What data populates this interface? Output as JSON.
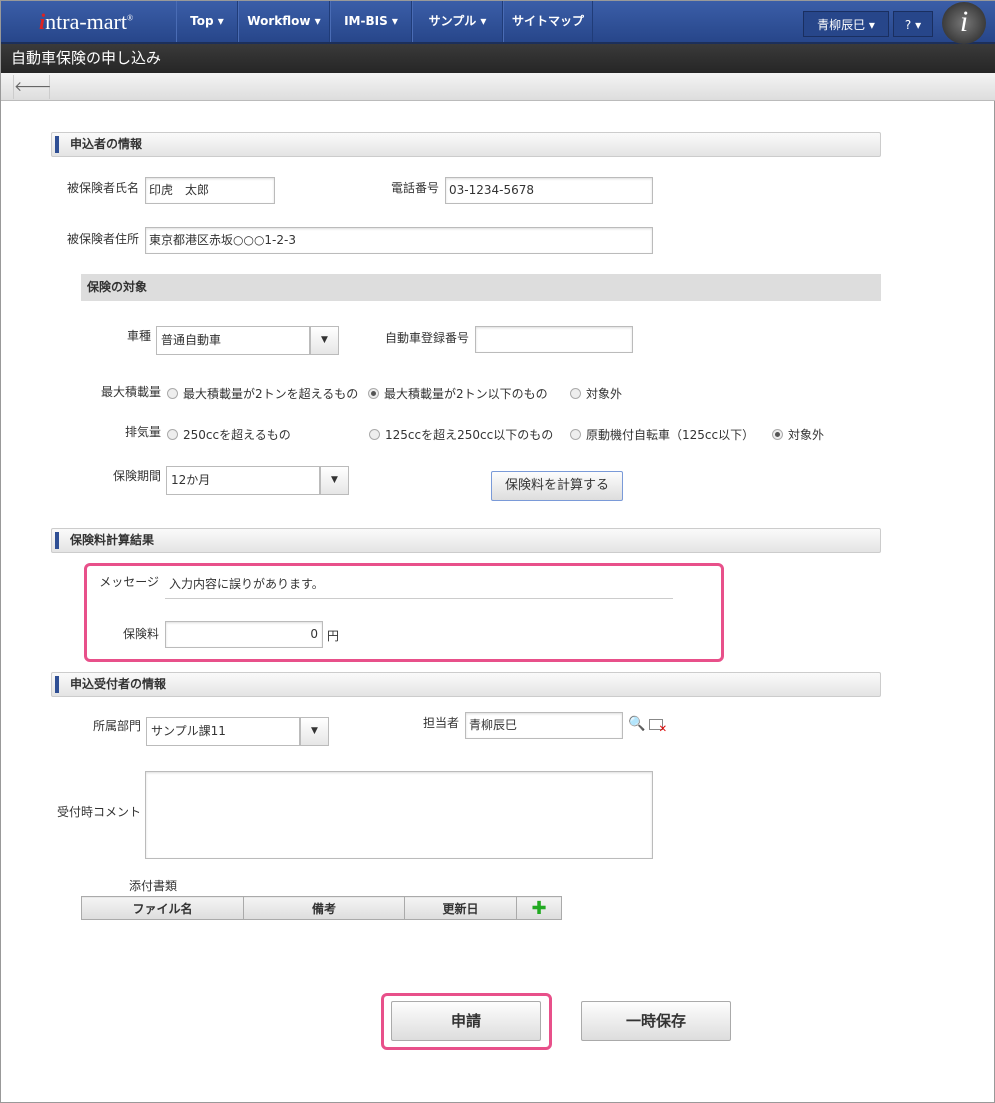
{
  "nav": {
    "logo": "intra-mart",
    "items": [
      "Top ▾",
      "Workflow ▾",
      "IM-BIS ▾",
      "サンプル ▾",
      "サイトマップ"
    ],
    "user": "青柳辰巳 ▾",
    "help": "? ▾"
  },
  "title": "自動車保険の申し込み",
  "sections": {
    "applicant": "申込者の情報",
    "target": "保険の対象",
    "result": "保険料計算結果",
    "receiver": "申込受付者の情報"
  },
  "applicant": {
    "name_label": "被保険者氏名",
    "name": "印虎　太郎",
    "phone_label": "電話番号",
    "phone": "03-1234-5678",
    "address_label": "被保険者住所",
    "address": "東京都港区赤坂○○○1-2-3"
  },
  "target": {
    "car_type_label": "車種",
    "car_type": "普通自動車",
    "reg_label": "自動車登録番号",
    "reg": "",
    "load_label": "最大積載量",
    "load_options": [
      "最大積載量が2トンを超えるもの",
      "最大積載量が2トン以下のもの",
      "対象外"
    ],
    "load_selected": 1,
    "exhaust_label": "排気量",
    "exhaust_options": [
      "250ccを超えるもの",
      "125ccを超え250cc以下のもの",
      "原動機付自転車（125cc以下）",
      "対象外"
    ],
    "exhaust_selected": 3,
    "period_label": "保険期間",
    "period": "12か月",
    "calc_button": "保険料を計算する"
  },
  "result": {
    "message_label": "メッセージ",
    "message": "入力内容に誤りがあります。",
    "fee_label": "保険料",
    "fee": "0",
    "unit": "円"
  },
  "receiver": {
    "dept_label": "所属部門",
    "dept": "サンプル課11",
    "person_label": "担当者",
    "person": "青柳辰巳",
    "comment_label": "受付時コメント",
    "comment": "",
    "attach_label": "添付書類",
    "columns": [
      "ファイル名",
      "備考",
      "更新日"
    ]
  },
  "buttons": {
    "apply": "申請",
    "save": "一時保存"
  }
}
